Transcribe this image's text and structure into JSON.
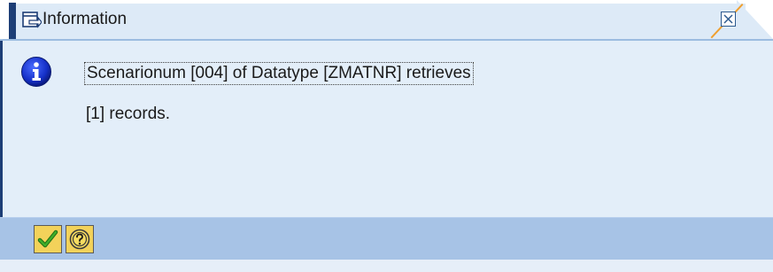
{
  "window": {
    "title": "Information",
    "title_icon": "dialog-window-icon",
    "close_icon": "close-x-icon"
  },
  "message": {
    "icon": "info-icon",
    "line1": "Scenarionum [004] of Datatype [ZMATNR] retrieves",
    "line2": "[1] records."
  },
  "toolbar": {
    "buttons": [
      {
        "name": "confirm",
        "icon": "checkmark-icon"
      },
      {
        "name": "help",
        "icon": "help-icon"
      }
    ]
  },
  "colors": {
    "title_accent": "#1d3e76",
    "dialog_background": "#e3eef9",
    "toolbar_background": "#a7c3e6",
    "info_icon_blue": "#1530c8",
    "button_yellow": "#f3d25a",
    "checkmark_green": "#2d8a1f"
  }
}
